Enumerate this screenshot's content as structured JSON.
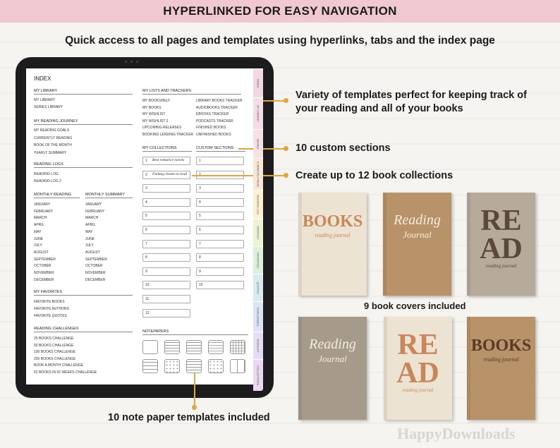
{
  "header": {
    "title": "HYPERLINKED FOR EASY NAVIGATION"
  },
  "subtitle": "Quick access to all pages and templates using hyperlinks, tabs and the index page",
  "planner": {
    "index_title": "INDEX",
    "my_library": {
      "heading": "MY LIBRARY",
      "items": [
        "MY LIBRARY",
        "SERIES LIBRARY"
      ]
    },
    "my_reading_journey": {
      "heading": "MY READING JOURNEY",
      "items": [
        "MY READING GOALS",
        "CURRENTLY READING",
        "BOOK OF THE MONTH",
        "YEARLY SUMMARY"
      ]
    },
    "reading_logs": {
      "heading": "READING LOGS",
      "items": [
        "READING LOG",
        "READING LOG 2"
      ]
    },
    "monthly_reading": {
      "heading": "MONTHLY READING",
      "items": [
        "JANUARY",
        "FEBRUARY",
        "MARCH",
        "APRIL",
        "MAY",
        "JUNE",
        "JULY",
        "AUGUST",
        "SEPTEMBER",
        "OCTOBER",
        "NOVEMBER",
        "DECEMBER"
      ]
    },
    "monthly_summary": {
      "heading": "MONTHLY SUMMARY",
      "items": [
        "JANUARY",
        "FEBRUARY",
        "MARCH",
        "APRIL",
        "MAY",
        "JUNE",
        "JULY",
        "AUGUST",
        "SEPTEMBER",
        "OCTOBER",
        "NOVEMBER",
        "DECEMBER"
      ]
    },
    "my_favorites": {
      "heading": "MY FAVORITES",
      "items": [
        "FAVORITE BOOKS",
        "FAVORITE AUTHORS",
        "FAVORITE QUOTES"
      ]
    },
    "reading_challenges": {
      "heading": "READING CHALLENGES",
      "items": [
        "25 BOOKS CHALLENGE",
        "50 BOOKS CHALLENGE",
        "100 BOOKS CHALLENGE",
        "200 BOOKS CHALLENGE",
        "BOOK A MONTH CHALLENGE",
        "52 BOOKS IN 52 WEEKS CHALLENGE"
      ]
    },
    "lists_trackers": {
      "heading": "MY LISTS AND TRACKERS",
      "col1": [
        "MY BOOKSHELF",
        "MY BOOKS",
        "MY WISHLIST",
        "MY WISHLIST 2",
        "UPCOMING RELEASES",
        "BOOKING LENDING TRACKER"
      ],
      "col2": [
        "LIBRARY BOOKS TRACKER",
        "AUDIOBOOKS TRACKER",
        "EBOOKS TRACKER",
        "PODCASTS TRACKER",
        "FINISHED BOOKS",
        "UNFINISHED BOOKS"
      ]
    },
    "collections": {
      "heading": "MY COLLECTIONS",
      "numbers": [
        "1",
        "2",
        "3",
        "4",
        "5",
        "6",
        "7",
        "8",
        "9",
        "10",
        "11",
        "12"
      ],
      "entries": [
        "Best romance novels",
        "Fantasy books to read"
      ]
    },
    "custom_sections": {
      "heading": "CUSTOM SECTIONS",
      "numbers": [
        "1",
        "2",
        "3",
        "4",
        "5",
        "6",
        "7",
        "8",
        "9",
        "10"
      ]
    },
    "notepapers": {
      "heading": "NOTEPAPERS"
    },
    "tabs": [
      "INDEX",
      "MY LIBRARY",
      "SERIES",
      "CURRENTLY READ",
      "READING LOG",
      "MONTHLY",
      "FAVORITES",
      "QUOTES",
      "CHALLENGES",
      "WISHLIST",
      "COLLECTIONS"
    ],
    "tab_colors": [
      "#f4d7e4",
      "#f4dde6",
      "#f7e0e6",
      "#f9e7d6",
      "#fbf1d2",
      "#eaf3d4",
      "#dcf0dc",
      "#d6ecef",
      "#dbe3f5",
      "#e4ddf5",
      "#ebd9f2"
    ]
  },
  "callouts": {
    "variety": "Variety of templates perfect for keeping track of your reading and all of your books",
    "custom_sections": "10 custom sections",
    "collections": "Create up to 12 book collections",
    "note_paper": "10 note paper templates included"
  },
  "covers_caption": "9 book covers included",
  "covers": [
    {
      "big": "BOOKS",
      "small": "reading journal",
      "bg": "#ede3d2",
      "ink": "#c8865a"
    },
    {
      "big": "Reading",
      "small": "Journal",
      "bg": "#b89268",
      "ink": "#f5ece0"
    },
    {
      "big": "RE AD",
      "small": "reading journal",
      "bg": "#b6aa9b",
      "ink": "#5a4838"
    },
    {
      "big": "Reading",
      "small": "Journal",
      "bg": "#a69a8b",
      "ink": "#f5ece0"
    },
    {
      "big": "RE AD",
      "small": "reading journal",
      "bg": "#ede3d2",
      "ink": "#c8865a"
    },
    {
      "big": "BOOKS",
      "small": "reading journal",
      "bg": "#b89268",
      "ink": "#5a3a28"
    }
  ],
  "watermark": "HappyDownloads",
  "accent": "#e2a73c",
  "banner_color": "#efc9cf"
}
